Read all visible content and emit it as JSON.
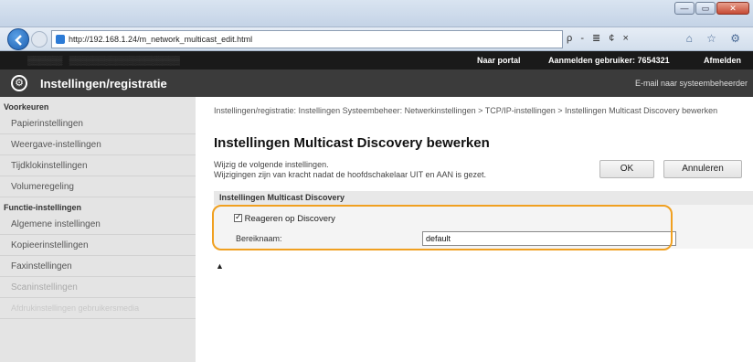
{
  "browser": {
    "url": "http://192.168.1.24/m_network_multicast_edit.html",
    "search_glyphs": "ρ - ≣ ¢ ×",
    "nav_icons": "⌂ ☆ ⚙"
  },
  "topbar": {
    "portal": "Naar portal",
    "login_label": "Aanmelden gebruiker:",
    "login_id": "7654321",
    "logout": "Afmelden"
  },
  "appbar": {
    "title": "Instellingen/registratie",
    "mail": "E-mail naar systeembeheerder"
  },
  "sidebar": {
    "section1": "Voorkeuren",
    "items1": [
      "Papierinstellingen",
      "Weergave-instellingen",
      "Tijdklokinstellingen",
      "Volumeregeling"
    ],
    "section2": "Functie-instellingen",
    "items2": [
      "Algemene instellingen",
      "Kopieerinstellingen",
      "Faxinstellingen",
      "Scaninstellingen",
      "Afdrukinstellingen gebruikersmedia"
    ]
  },
  "main": {
    "breadcrumb": "Instellingen/registratie: Instellingen Systeembeheer: Netwerkinstellingen > TCP/IP-instellingen > Instellingen Multicast Discovery bewerken",
    "title": "Instellingen Multicast Discovery bewerken",
    "desc_line1": "Wijzig de volgende instellingen.",
    "desc_line2": "Wijzigingen zijn van kracht nadat de hoofdschakelaar UIT en AAN is gezet.",
    "ok_label": "OK",
    "cancel_label": "Annuleren",
    "section_title": "Instellingen Multicast Discovery",
    "checkbox_label": "Reageren op Discovery",
    "scope_label": "Bereiknaam:",
    "scope_value": "default",
    "top_arrow": "▲"
  }
}
